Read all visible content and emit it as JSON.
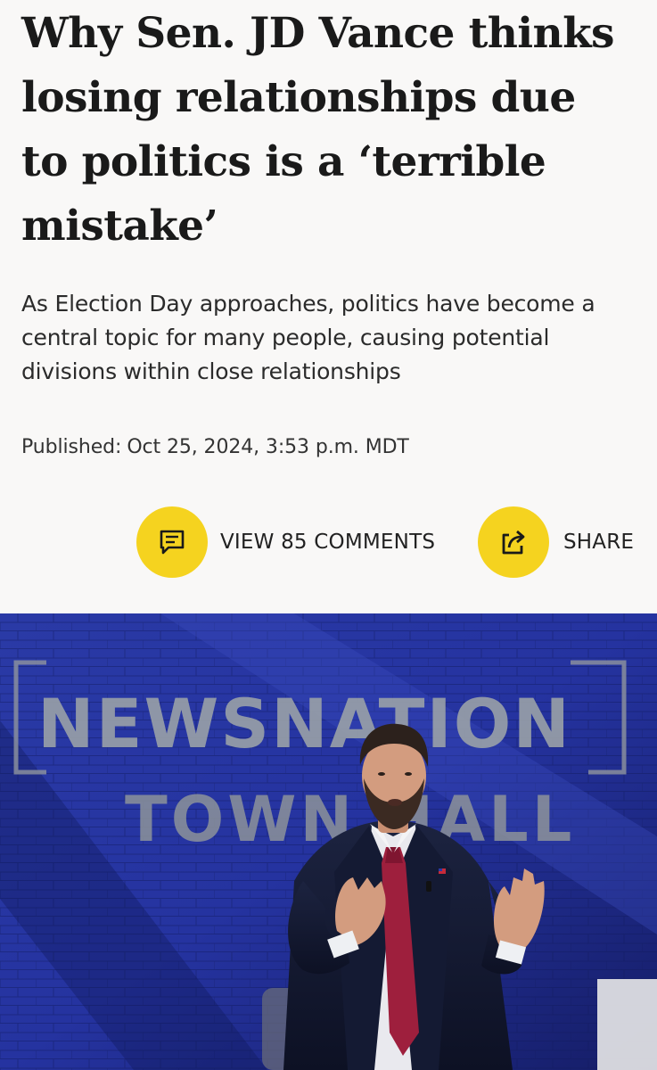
{
  "article": {
    "headline": "Why Sen. JD Vance thinks losing relationships due to politics is a ‘terrible mistake’",
    "dek": "As Election Day approaches, politics have become a central topic for many people, causing potential divisions within close relationships",
    "published_label": "Published:",
    "published_date": "Oct 25, 2024, 3:53 p.m. MDT"
  },
  "actions": {
    "comments_label": "VIEW 85 COMMENTS",
    "comments_icon": "comment-icon",
    "share_label": "SHARE",
    "share_icon": "share-icon",
    "accent_color": "#f5d31f"
  },
  "photo": {
    "backdrop_line1": "NEWSNATION",
    "backdrop_line2": "TOWN HALL"
  }
}
